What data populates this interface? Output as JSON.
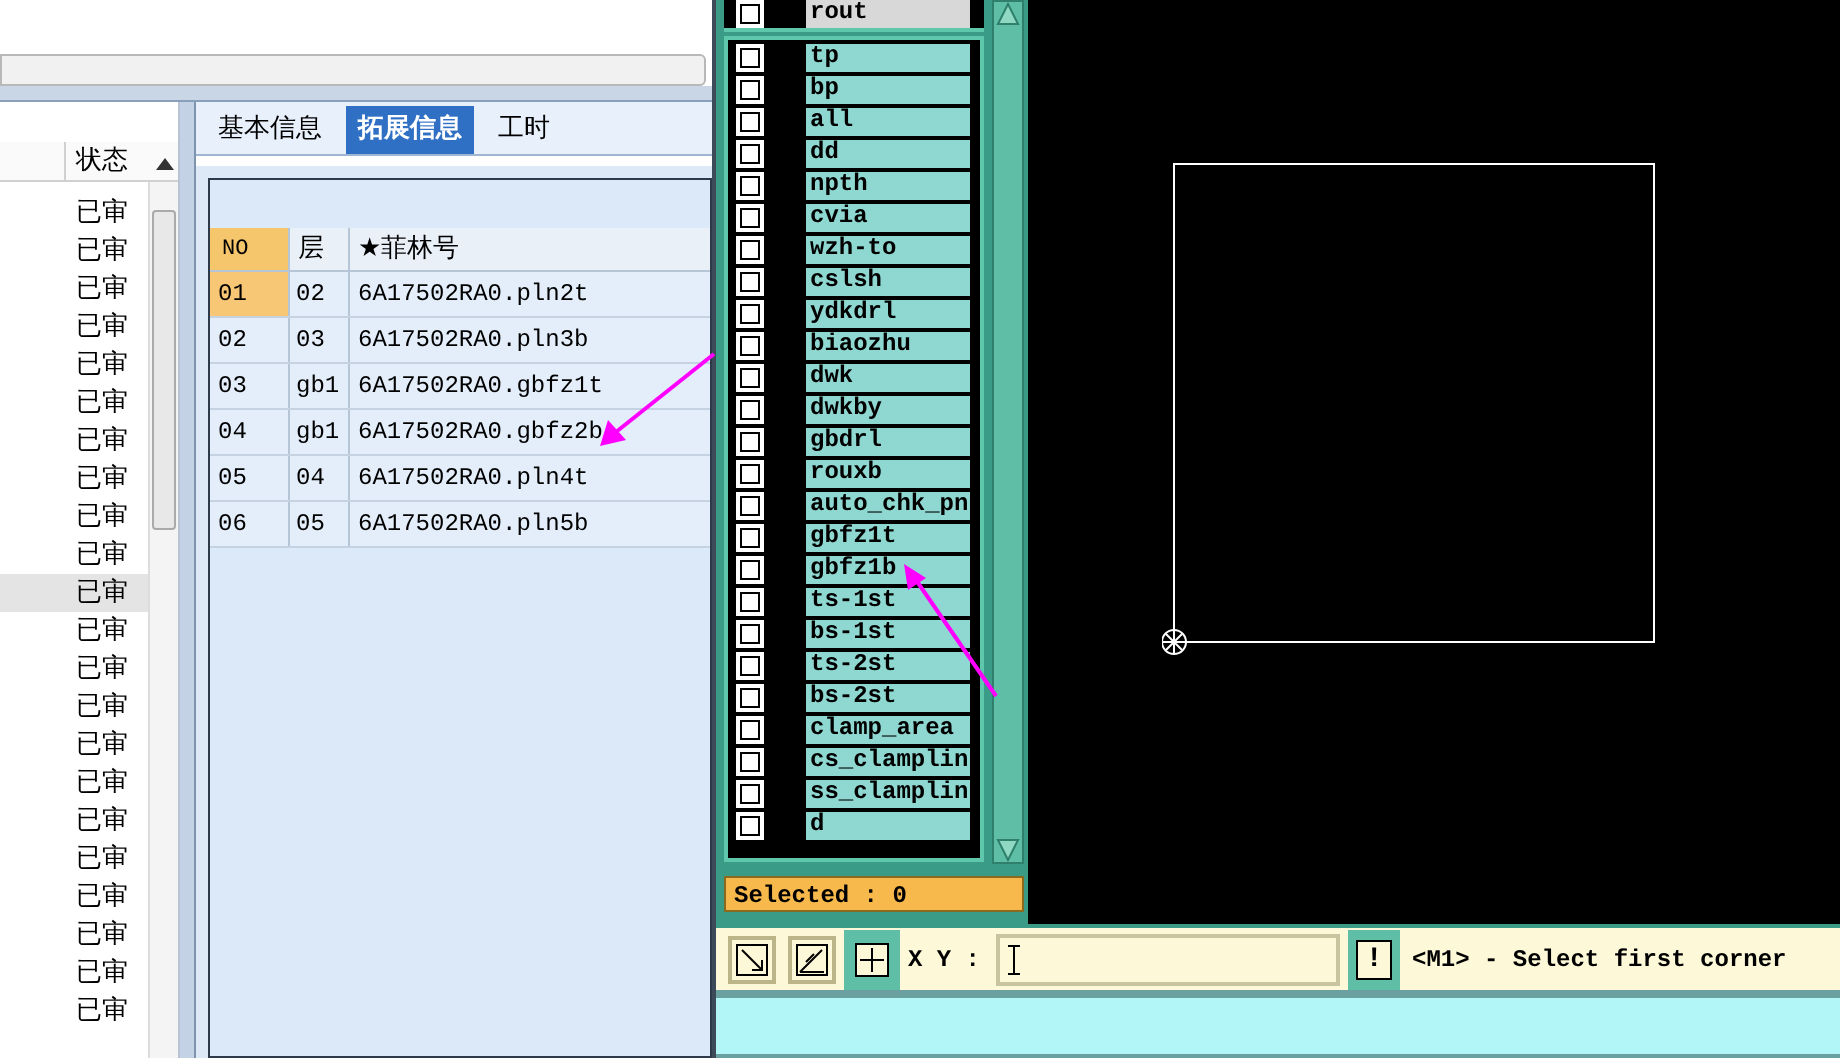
{
  "status_list": {
    "header": "状态",
    "rows": [
      {
        "text": "已审",
        "selected": false
      },
      {
        "text": "已审",
        "selected": false
      },
      {
        "text": "已审",
        "selected": false
      },
      {
        "text": "已审",
        "selected": false
      },
      {
        "text": "已审",
        "selected": false
      },
      {
        "text": "已审",
        "selected": false
      },
      {
        "text": "已审",
        "selected": false
      },
      {
        "text": "已审",
        "selected": false
      },
      {
        "text": "已审",
        "selected": false
      },
      {
        "text": "已审",
        "selected": false
      },
      {
        "text": "已审",
        "selected": true
      },
      {
        "text": "已审",
        "selected": false
      },
      {
        "text": "已审",
        "selected": false
      },
      {
        "text": "已审",
        "selected": false
      },
      {
        "text": "已审",
        "selected": false
      },
      {
        "text": "已审",
        "selected": false
      },
      {
        "text": "已审",
        "selected": false
      },
      {
        "text": "已审",
        "selected": false
      },
      {
        "text": "已审",
        "selected": false
      },
      {
        "text": "已审",
        "selected": false
      },
      {
        "text": "已审",
        "selected": false
      },
      {
        "text": "已审",
        "selected": false
      }
    ]
  },
  "tabs": [
    {
      "label": "基本信息",
      "selected": false
    },
    {
      "label": "拓展信息",
      "selected": true
    },
    {
      "label": "工时",
      "selected": false
    }
  ],
  "film_table": {
    "columns": [
      "NO",
      "层",
      "★菲林号"
    ],
    "rows": [
      {
        "no": "01",
        "layer": "02",
        "film": "6A17502RA0.pln2t",
        "selected": true
      },
      {
        "no": "02",
        "layer": "03",
        "film": "6A17502RA0.pln3b",
        "selected": false
      },
      {
        "no": "03",
        "layer": "gb1",
        "film": "6A17502RA0.gbfz1t",
        "selected": false
      },
      {
        "no": "04",
        "layer": "gb1",
        "film": "6A17502RA0.gbfz2b",
        "selected": false
      },
      {
        "no": "05",
        "layer": "04",
        "film": "6A17502RA0.pln4t",
        "selected": false
      },
      {
        "no": "06",
        "layer": "05",
        "film": "6A17502RA0.pln5b",
        "selected": false
      }
    ]
  },
  "layer_panel": {
    "layers": [
      {
        "name": "rout",
        "checked": false,
        "highlighted": true
      },
      {
        "name": "tp",
        "checked": false,
        "highlighted": false
      },
      {
        "name": "bp",
        "checked": false,
        "highlighted": false
      },
      {
        "name": "all",
        "checked": false,
        "highlighted": false
      },
      {
        "name": "dd",
        "checked": false,
        "highlighted": false
      },
      {
        "name": "npth",
        "checked": false,
        "highlighted": false
      },
      {
        "name": "cvia",
        "checked": false,
        "highlighted": false
      },
      {
        "name": "wzh-to",
        "checked": false,
        "highlighted": false
      },
      {
        "name": "cslsh",
        "checked": false,
        "highlighted": false
      },
      {
        "name": "ydkdrl",
        "checked": false,
        "highlighted": false
      },
      {
        "name": "biaozhu",
        "checked": false,
        "highlighted": false
      },
      {
        "name": "dwk",
        "checked": false,
        "highlighted": false
      },
      {
        "name": "dwkby",
        "checked": false,
        "highlighted": false
      },
      {
        "name": "gbdrl",
        "checked": false,
        "highlighted": false
      },
      {
        "name": "rouxb",
        "checked": false,
        "highlighted": false
      },
      {
        "name": "auto_chk_pn",
        "checked": false,
        "highlighted": false
      },
      {
        "name": "gbfz1t",
        "checked": false,
        "highlighted": false
      },
      {
        "name": "gbfz1b",
        "checked": false,
        "highlighted": false
      },
      {
        "name": "ts-1st",
        "checked": false,
        "highlighted": false
      },
      {
        "name": "bs-1st",
        "checked": false,
        "highlighted": false
      },
      {
        "name": "ts-2st",
        "checked": false,
        "highlighted": false
      },
      {
        "name": "bs-2st",
        "checked": false,
        "highlighted": false
      },
      {
        "name": "clamp_area",
        "checked": false,
        "highlighted": false
      },
      {
        "name": "cs_clamplin",
        "checked": false,
        "highlighted": false
      },
      {
        "name": "ss_clamplin",
        "checked": false,
        "highlighted": false
      },
      {
        "name": "d",
        "checked": false,
        "highlighted": false
      }
    ],
    "selected_count": "Selected : 0"
  },
  "command_bar": {
    "xy_label": "X Y :",
    "alert_button": "!",
    "message": "<M1> - Select first corner"
  }
}
